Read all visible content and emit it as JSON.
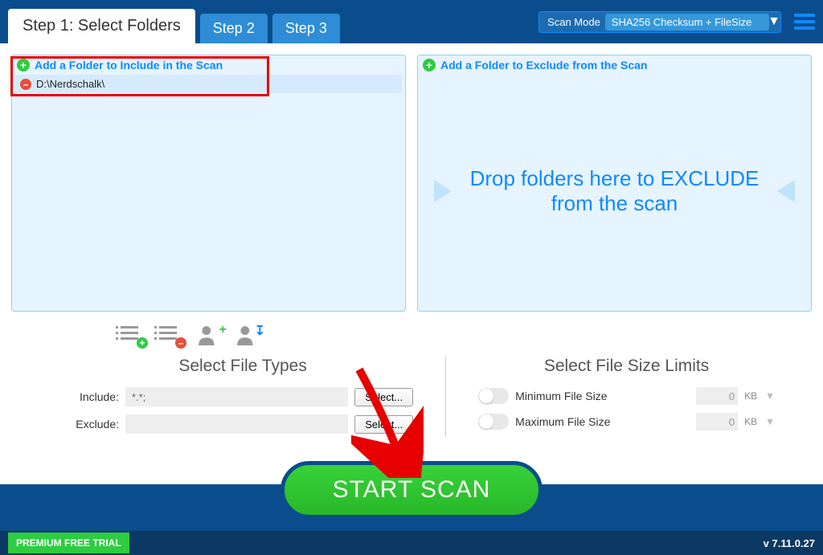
{
  "tabs": {
    "step1": "Step 1: Select Folders",
    "step2": "Step 2",
    "step3": "Step 3"
  },
  "scanMode": {
    "label": "Scan Mode",
    "value": "SHA256 Checksum + FileSize"
  },
  "includePanel": {
    "addLabel": "Add a Folder to Include in the Scan",
    "folders": [
      "D:\\Nerdschalk\\"
    ]
  },
  "excludePanel": {
    "addLabel": "Add a Folder to Exclude from the Scan",
    "dropMessage": "Drop folders here to EXCLUDE from the scan"
  },
  "fileTypes": {
    "title": "Select File Types",
    "includeLabel": "Include:",
    "includeValue": "*.*;",
    "excludeLabel": "Exclude:",
    "excludeValue": "",
    "selectBtn": "Select..."
  },
  "fileSize": {
    "title": "Select File Size Limits",
    "minLabel": "Minimum File Size",
    "minValue": "0",
    "maxLabel": "Maximum File Size",
    "maxValue": "0",
    "unit": "KB"
  },
  "startScan": "START SCAN",
  "footer": {
    "trial": "PREMIUM FREE TRIAL",
    "version": "v 7.11.0.27"
  }
}
